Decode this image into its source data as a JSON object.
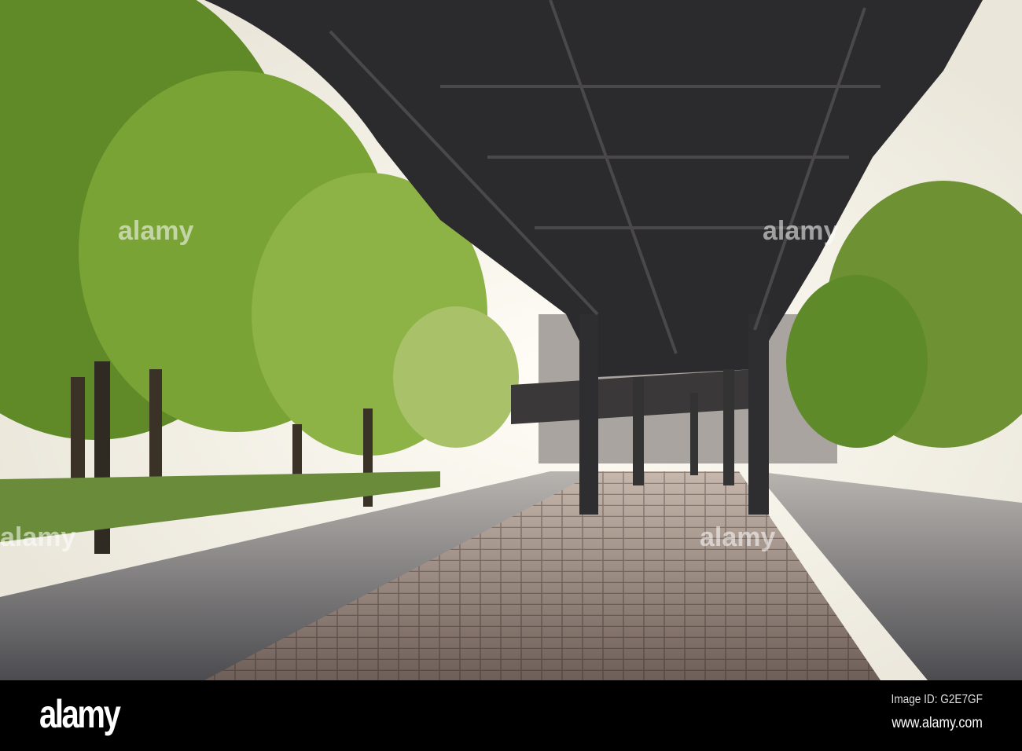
{
  "watermark": {
    "logo": "alamy",
    "image_id": "Image ID: G2E7GF",
    "url": "www.alamy.com"
  },
  "colors": {
    "sky": "#f4f1e8",
    "foliage": "#6f9a2e",
    "steel": "#2b2a2c",
    "road": "#5a5a5e",
    "cobble": "#8a7a72"
  }
}
